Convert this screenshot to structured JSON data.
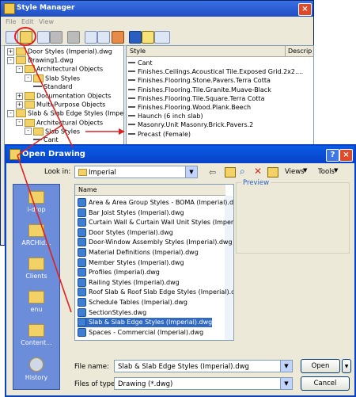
{
  "style_manager": {
    "title": "Style Manager",
    "menu": [
      "File",
      "Edit",
      "View"
    ],
    "toolbar_icons": [
      "new-icon",
      "open-drawing-icon",
      "copy-icon",
      "paste-icon",
      "edit-icon",
      "purge-icon",
      "sort-icon",
      "toggle-view-icon",
      "help-icon",
      "view-icon"
    ],
    "tree": [
      {
        "label": "Door Styles (Imperial).dwg",
        "level": 0,
        "pm": "+"
      },
      {
        "label": "Drawing1.dwg",
        "level": 0,
        "pm": "-"
      },
      {
        "label": "Architectural Objects",
        "level": 1,
        "pm": "-"
      },
      {
        "label": "Slab Styles",
        "level": 2,
        "pm": "-"
      },
      {
        "label": "Standard",
        "level": 3,
        "pm": ""
      },
      {
        "label": "Documentation Objects",
        "level": 1,
        "pm": "+"
      },
      {
        "label": "Multi-Purpose Objects",
        "level": 1,
        "pm": "+"
      },
      {
        "label": "Slab & Slab Edge Styles (Imperial",
        "level": 0,
        "pm": "-"
      },
      {
        "label": "Architectural Objects",
        "level": 1,
        "pm": "-"
      },
      {
        "label": "Slab Styles",
        "level": 2,
        "pm": "-"
      },
      {
        "label": "Cant",
        "level": 3,
        "pm": ""
      }
    ],
    "list_headers": [
      "Style",
      "Descrip"
    ],
    "list_items": [
      "Cant",
      "Finishes.Ceilings.Acoustical Tile.Exposed Grid.2x2....",
      "Finishes.Flooring.Stone.Pavers.Terra Cotta",
      "Finishes.Flooring.Tile.Granite.Muave-Black",
      "Finishes.Flooring.Tile.Square.Terra Cotta",
      "Finishes.Flooring.Wood.Plank.Beech",
      "Haunch (6 inch slab)",
      "Masonry.Unit Masonry.Brick.Pavers.2",
      "Precast (Female)"
    ]
  },
  "open_drawing": {
    "title": "Open Drawing",
    "look_in_label": "Look in:",
    "look_in_value": "Imperial",
    "views_label": "Views",
    "tools_label": "Tools",
    "preview_label": "Preview",
    "name_header": "Name",
    "places": [
      "i-drop",
      "ARCHId...",
      "Clients",
      "enu",
      "Content...",
      "History"
    ],
    "files": [
      "Area & Area Group Styles - BOMA (Imperial).d...",
      "Bar Joist Styles (Imperial).dwg",
      "Curtain Wall & Curtain Wall Unit Styles (Imperial).dwg",
      "Door Styles (Imperial).dwg",
      "Door-Window Assembly Styles (Imperial).dwg",
      "Material Definitions (Imperial).dwg",
      "Member Styles (Imperial).dwg",
      "Profiles (Imperial).dwg",
      "Railing Styles (Imperial).dwg",
      "Roof Slab & Roof Slab Edge Styles (Imperial).dwg",
      "Schedule Tables (Imperial).dwg",
      "SectionStyles.dwg",
      "Slab & Slab Edge Styles (Imperial).dwg",
      "Spaces - Commercial (Imperial).dwg"
    ],
    "selected_index": 12,
    "file_name_label": "File name:",
    "file_name_value": "Slab & Slab Edge Styles (Imperial).dwg",
    "file_type_label": "Files of type:",
    "file_type_value": "Drawing (*.dwg)",
    "open_label": "Open",
    "cancel_label": "Cancel"
  },
  "colors": {
    "titlebar": "#0842C9",
    "annotation": "#E02020",
    "selection": "#316AC5"
  }
}
